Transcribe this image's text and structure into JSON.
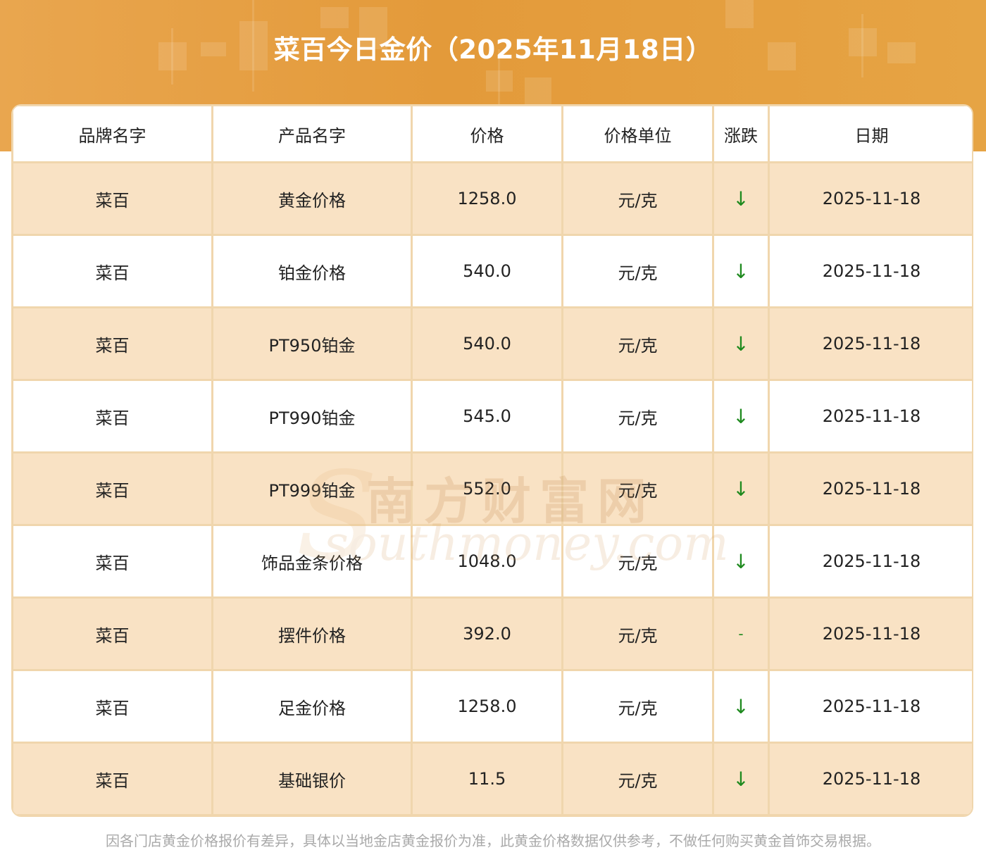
{
  "title": "菜百今日金价（2025年11月18日）",
  "columns": [
    "品牌名字",
    "产品名字",
    "价格",
    "价格单位",
    "涨跌",
    "日期"
  ],
  "rows": [
    {
      "brand": "菜百",
      "product": "黄金价格",
      "price": "1258.0",
      "unit": "元/克",
      "change": "↓",
      "date": "2025-11-18"
    },
    {
      "brand": "菜百",
      "product": "铂金价格",
      "price": "540.0",
      "unit": "元/克",
      "change": "↓",
      "date": "2025-11-18"
    },
    {
      "brand": "菜百",
      "product": "PT950铂金",
      "price": "540.0",
      "unit": "元/克",
      "change": "↓",
      "date": "2025-11-18"
    },
    {
      "brand": "菜百",
      "product": "PT990铂金",
      "price": "545.0",
      "unit": "元/克",
      "change": "↓",
      "date": "2025-11-18"
    },
    {
      "brand": "菜百",
      "product": "PT999铂金",
      "price": "552.0",
      "unit": "元/克",
      "change": "↓",
      "date": "2025-11-18"
    },
    {
      "brand": "菜百",
      "product": "饰品金条价格",
      "price": "1048.0",
      "unit": "元/克",
      "change": "↓",
      "date": "2025-11-18"
    },
    {
      "brand": "菜百",
      "product": "摆件价格",
      "price": "392.0",
      "unit": "元/克",
      "change": "-",
      "date": "2025-11-18"
    },
    {
      "brand": "菜百",
      "product": "足金价格",
      "price": "1258.0",
      "unit": "元/克",
      "change": "↓",
      "date": "2025-11-18"
    },
    {
      "brand": "菜百",
      "product": "基础银价",
      "price": "11.5",
      "unit": "元/克",
      "change": "↓",
      "date": "2025-11-18"
    }
  ],
  "watermark": {
    "cn": "南方财富网",
    "en": "southmoney.com"
  },
  "footnote": "因各门店黄金价格报价有差异，具体以当地金店黄金报价为准，此黄金价格数据仅供参考，不做任何购买黄金首饰交易根据。",
  "colors": {
    "header": "#e39a3a",
    "row_highlight": "#f9e2c4",
    "border": "#f0d6ad",
    "down": "#1f8a1f"
  }
}
